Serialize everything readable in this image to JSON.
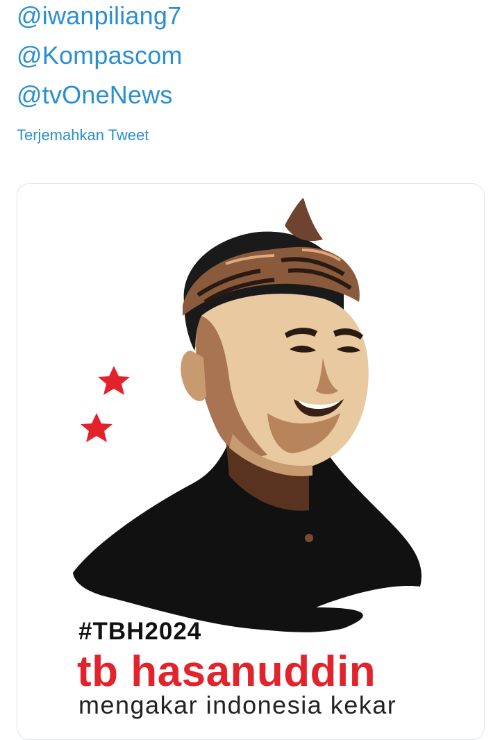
{
  "tweet": {
    "mentions": [
      "@iwanpiliang7",
      "@Kompascom",
      "@tvOneNews"
    ],
    "translate_label": "Terjemahkan Tweet"
  },
  "poster": {
    "hashtag": "#TBH2024",
    "name": "tb hasanuddin",
    "tagline": "mengakar indonesia kekar"
  },
  "colors": {
    "link": "#2a8fd0",
    "name_red": "#e3232c",
    "star_red": "#e3232c",
    "jacket_black": "#111111",
    "skin_light": "#e8c9a0",
    "skin_shadow": "#a97452",
    "headband": "#8a5a3c"
  },
  "icons": [
    "star-icon",
    "star-icon"
  ]
}
